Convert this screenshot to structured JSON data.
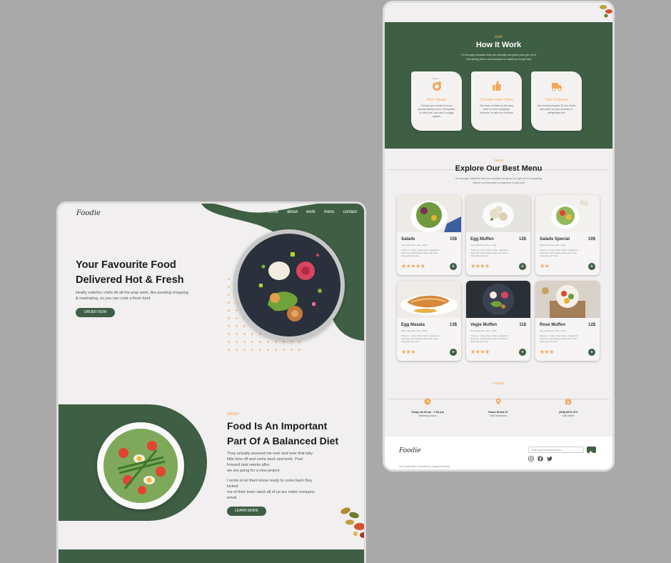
{
  "colors": {
    "primary": "#3f5f45",
    "accent": "#f2a75b",
    "page_bg": "#f1efef",
    "canvas": "#a9a9a9"
  },
  "left_page": {
    "logo": "Foodie",
    "nav": [
      "home",
      "about",
      "work",
      "menu",
      "contact"
    ],
    "hero": {
      "title_line1": "Your Favourite Food",
      "title_line2": "Delivered Hot & Fresh",
      "subtitle_line1": "Healty switcher chefs do all the prep work, like peeding chopping",
      "subtitle_line2": "& marinating, so you can cook a fresh food",
      "cta": "ORDER NOW"
    },
    "about": {
      "tag": "about",
      "title_line1": "Food Is An Important",
      "title_line2": "Part Of A Balanced Diet",
      "para1": [
        "They actually assured me over and over that taky",
        "little time off and come back and work. Post",
        "forward task weeks after.",
        "we are going for a new project"
      ],
      "para2": [
        "I wrote to let them know ready to come back they",
        "kicked",
        "me of their team stack all of us are make company",
        "email"
      ],
      "cta": "LEARN MORE"
    }
  },
  "right_page": {
    "how": {
      "tag": "work",
      "title": "How It Work",
      "sub_line1": "It's through mistakes that you actually can grow yous get rid of",
      "sub_line2": "everything that is not essential to makihone to get bad",
      "steps": [
        {
          "icon": "pick-meals-icon",
          "badge": "Muslim",
          "title": "Pick Meals",
          "desc": [
            "Choose your meals from our",
            "diverse weekly menu. Find gluten",
            "or dairy free, low carb & veggie",
            "options"
          ]
        },
        {
          "icon": "thumbs-up-icon",
          "badge": "",
          "title": "Choose How Often",
          "desc": [
            "Our team of chefs do the prep",
            "work no more shopping,",
            "measure, or sink full of dishes"
          ]
        },
        {
          "icon": "delivery-truck-icon",
          "badge": "",
          "title": "Fast Delivery",
          "desc": [
            "Your freshly prepped 15 min dinner",
            "kits arrive on your doorstep in",
            "refrigerated box"
          ]
        }
      ]
    },
    "menu": {
      "tag": "menu",
      "title": "Explore Our Best Menu",
      "sub_line1": "It's through mistakes that you actually can grow you get rid of everything",
      "sub_line2": "that is not essential to makihone to get bad",
      "items": [
        {
          "name": "Salads",
          "price": "15$",
          "small": "Serve with Fries, Flav + Coke",
          "desc": [
            "Choice of : Coke, Fanta, Sprite, Upgrade to",
            "large fries, Add whopper patty, Add tender",
            "crisp patty and more"
          ],
          "stars": "★★★★★"
        },
        {
          "name": "Egg Muffen",
          "price": "12$",
          "small": "Serve with Fries, Flav + Coke",
          "desc": [
            "Choice of : Coke, Fanta, Sprite, Upgrade to",
            "large fries, Add whopper patty, Add tender",
            "crisp patty and more"
          ],
          "stars": "★★★★"
        },
        {
          "name": "Salads Special",
          "price": "10$",
          "small": "Serve with Fries, Flav + Coke",
          "desc": [
            "Choice of : Coke, Fanta, Sprite, Upgrade to",
            "large fries, Add whopper patty, Add tender",
            "crisp patty and more"
          ],
          "stars": "★★"
        },
        {
          "name": "Egg Masala",
          "price": "13$",
          "small": "Serve with Fries, Flav + Coke",
          "desc": [
            "Choice of : Coke, Fanta, Sprite, Upgrade to",
            "large fries, Add whopper patty, Add tender",
            "crisp patty and more"
          ],
          "stars": "★★★"
        },
        {
          "name": "Vegie Muffen",
          "price": "11$",
          "small": "Serve with Fries, Flav + Coke",
          "desc": [
            "Choice of : Coke, Fanta, Sprite, Upgrade to",
            "large fries, Add whopper patty, Add tender",
            "crisp patty and more"
          ],
          "stars": "★★★★"
        },
        {
          "name": "Rose Muffen",
          "price": "12$",
          "small": "Serve with Fries, Flav + Coke",
          "desc": [
            "Choice of : Coke, Fanta, Sprite, Upgrade to",
            "large fries, Add whopper patty, Add tender",
            "crisp patty and more"
          ],
          "stars": "★★★"
        }
      ]
    },
    "contact": {
      "tag": "contact",
      "items": [
        {
          "icon": "clock-icon",
          "value": "Today 10:00 am - 7:00 pm",
          "label": "Working Hours"
        },
        {
          "icon": "location-pin-icon",
          "value": "Paras Street 07",
          "label": "Get Directions"
        },
        {
          "icon": "phone-icon",
          "value": "(538) 8376 474",
          "label": "call online"
        }
      ]
    },
    "footer": {
      "logo": "Foodie",
      "email_placeholder": "Email at all foodie@gmail.com",
      "copyright": "2022 gold rights reserved by vinayok Shaunty"
    }
  }
}
